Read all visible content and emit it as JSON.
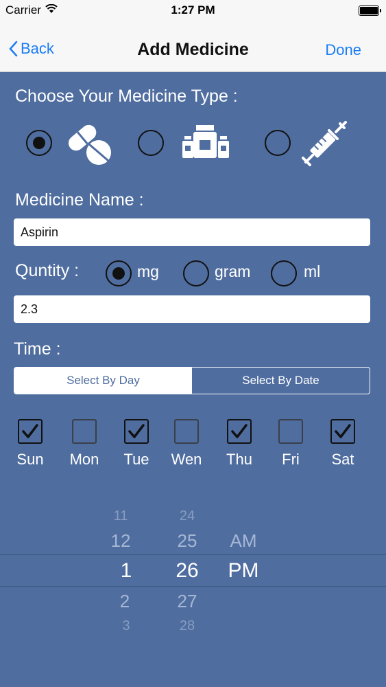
{
  "status": {
    "carrier": "Carrier",
    "time": "1:27 PM"
  },
  "nav": {
    "back": "Back",
    "title": "Add Medicine",
    "done": "Done"
  },
  "medicine_type": {
    "label": "Choose Your Medicine Type :",
    "selected": "pills",
    "options": [
      "pills-icon",
      "bottles-icon",
      "syringe-icon"
    ]
  },
  "medicine_name": {
    "label": "Medicine Name :",
    "value": "Aspirin"
  },
  "quantity": {
    "label": "Quntity :",
    "units": [
      "mg",
      "gram",
      "ml"
    ],
    "selected_unit": "mg",
    "value": "2.3"
  },
  "time": {
    "label": "Time :",
    "segments": [
      "Select By Day",
      "Select By Date"
    ],
    "selected_segment": "Select By Day"
  },
  "days": [
    {
      "name": "Sun",
      "checked": true
    },
    {
      "name": "Mon",
      "checked": false
    },
    {
      "name": "Tue",
      "checked": true
    },
    {
      "name": "Wen",
      "checked": false
    },
    {
      "name": "Thu",
      "checked": true
    },
    {
      "name": "Fri",
      "checked": false
    },
    {
      "name": "Sat",
      "checked": true
    }
  ],
  "picker": {
    "hours": [
      "11",
      "12",
      "1",
      "2",
      "3"
    ],
    "minutes": [
      "24",
      "25",
      "26",
      "27",
      "28"
    ],
    "ampm": [
      "AM",
      "PM"
    ]
  },
  "colors": {
    "background": "#4f6d9f",
    "accent": "#1a7cf5"
  }
}
